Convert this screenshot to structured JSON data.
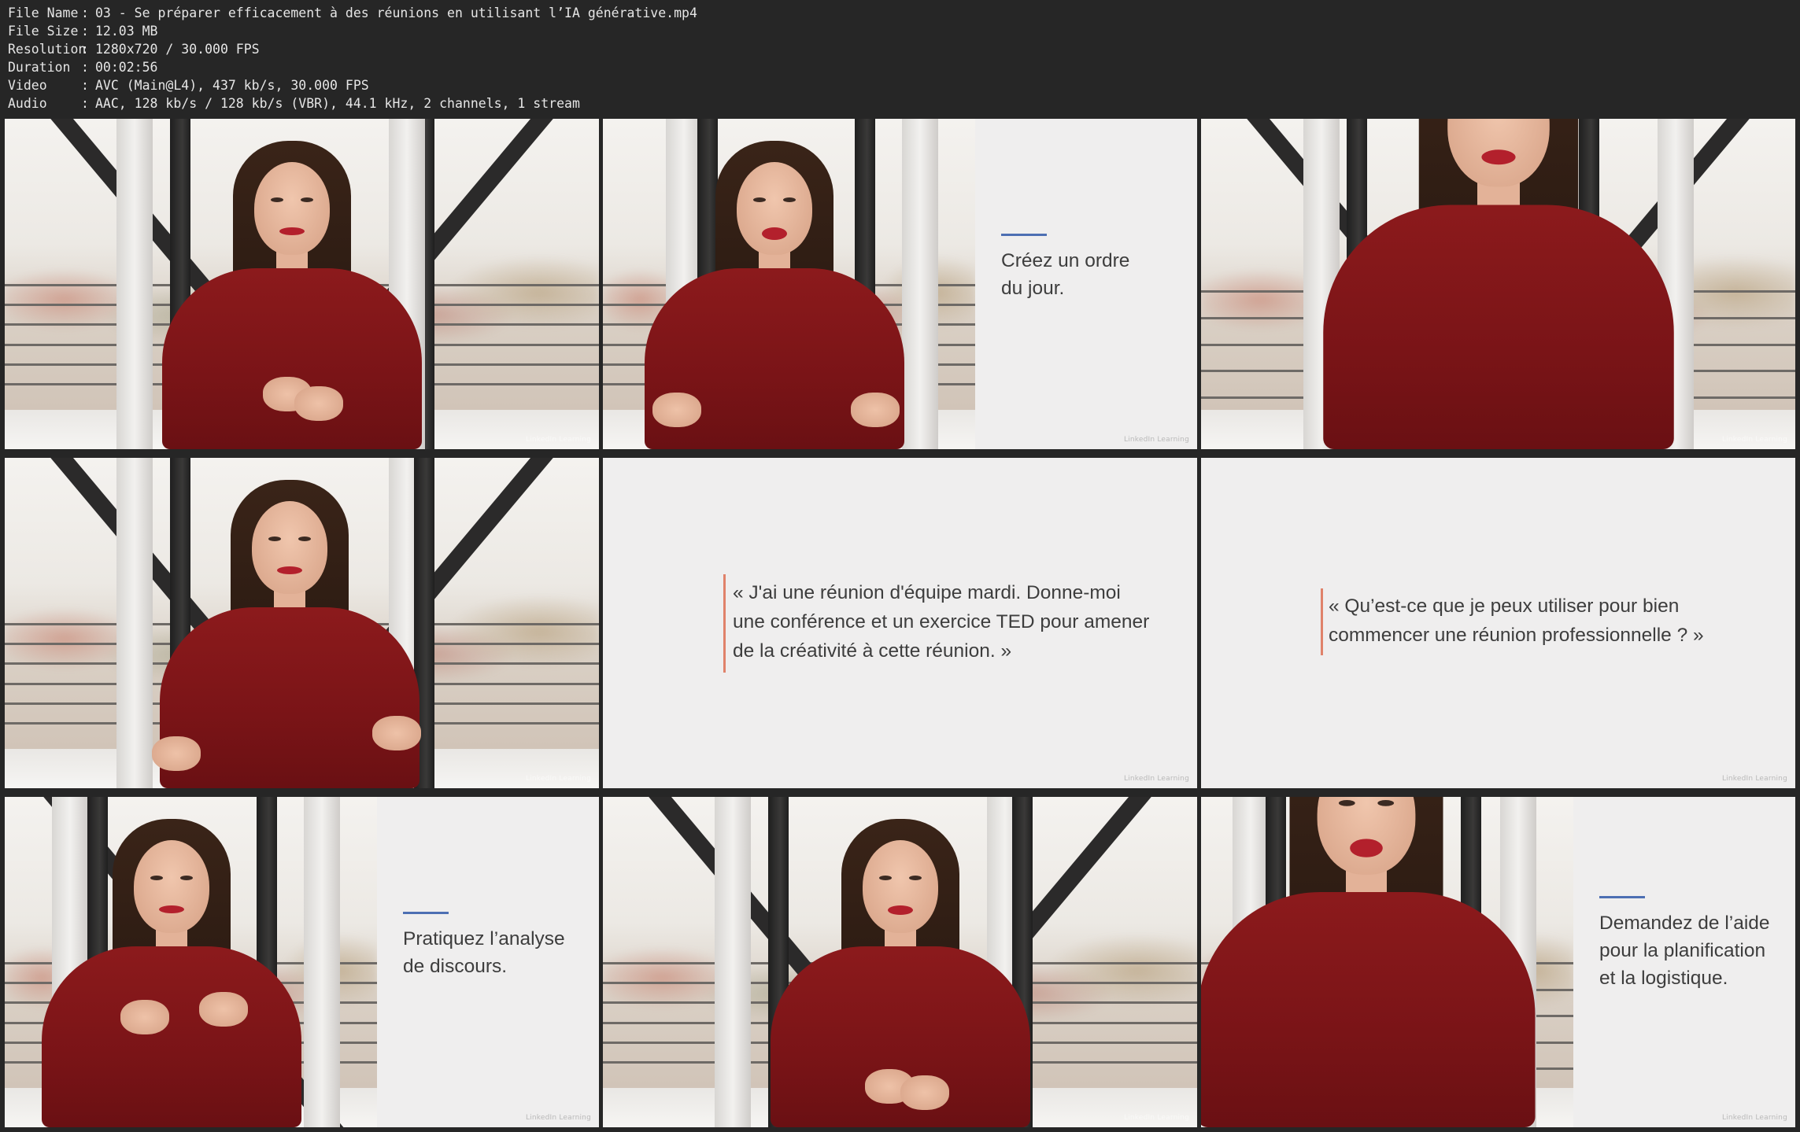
{
  "meta": {
    "rows": [
      {
        "key": "File Name",
        "sep": ":",
        "value": "03 - Se préparer efficacement à des réunions en utilisant l’IA générative.mp4"
      },
      {
        "key": "File Size",
        "sep": ":",
        "value": "12.03 MB"
      },
      {
        "key": "Resolution",
        "sep": ":",
        "value": "1280x720 / 30.000 FPS"
      },
      {
        "key": "Duration",
        "sep": ":",
        "value": "00:02:56"
      },
      {
        "key": "Video",
        "sep": ":",
        "value": "AVC (Main@L4), 437 kb/s, 30.000 FPS"
      },
      {
        "key": "Audio",
        "sep": ":",
        "value": "AAC, 128 kb/s / 128 kb/s (VBR), 44.1 kHz, 2 channels, 1 stream"
      }
    ]
  },
  "watermark": "LinkedIn Learning",
  "thumbs": [
    {
      "type": "presenter"
    },
    {
      "type": "presenter_with_panel",
      "panel_text": "Créez un ordre\ndu jour."
    },
    {
      "type": "presenter"
    },
    {
      "type": "presenter"
    },
    {
      "type": "quote",
      "text": "« J'ai une réunion d'équipe mardi. Donne-moi\n  une conférence et un exercice TED pour amener\n  de la créativité à cette réunion. »"
    },
    {
      "type": "quote",
      "text": "« Qu’est-ce que je peux utiliser pour bien\n  commencer une réunion professionnelle ? »"
    },
    {
      "type": "presenter_with_panel",
      "panel_text": "Pratiquez l’analyse\nde discours."
    },
    {
      "type": "presenter"
    },
    {
      "type": "presenter_with_panel",
      "panel_text": "Demandez de l’aide\npour la planification\net la logistique."
    }
  ],
  "colors": {
    "background": "#262626",
    "panel": "#efeeee",
    "accent_blue": "#4d6fb3",
    "accent_orange": "#e0826a",
    "sweater": "#8c1a1c"
  }
}
